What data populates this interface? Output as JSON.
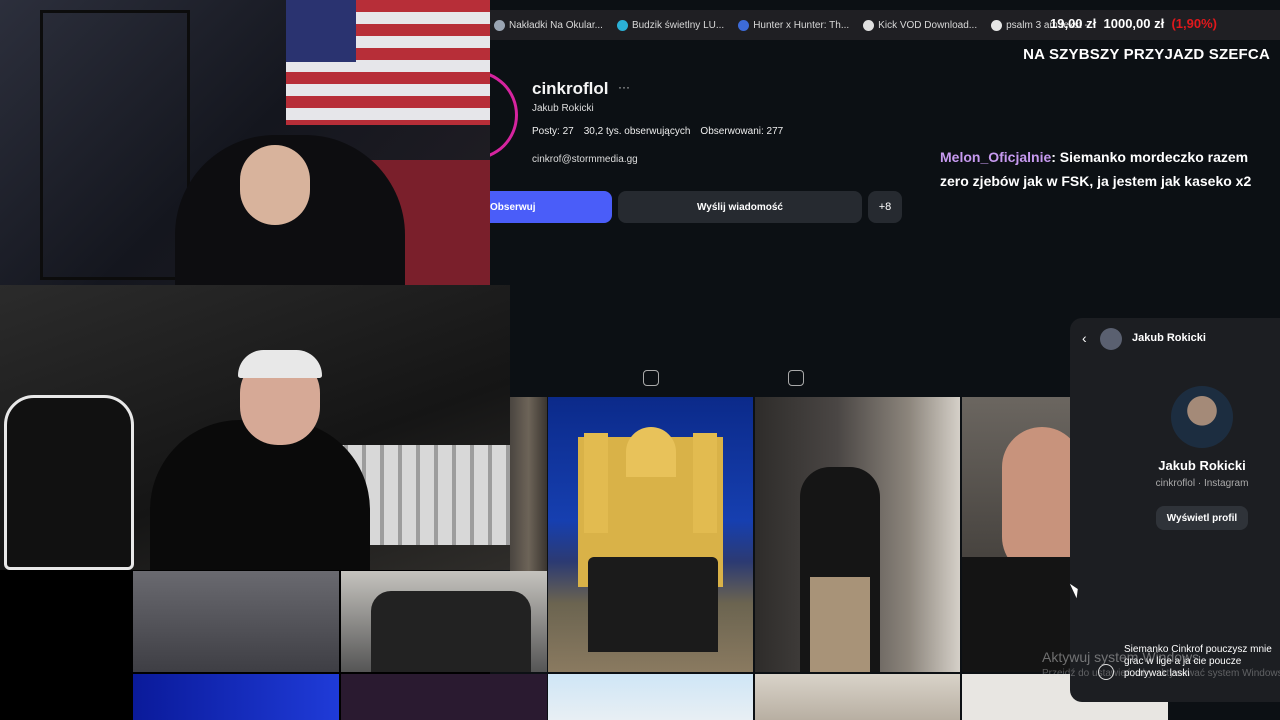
{
  "bookmarks": [
    {
      "label": "Nakładki Na Okular...",
      "color": "#9aa4b2"
    },
    {
      "label": "Budzik świetlny LU...",
      "color": "#2bb0d6"
    },
    {
      "label": "Hunter x Hunter: Th...",
      "color": "#3d6bd8"
    },
    {
      "label": "Kick VOD Download...",
      "color": "#e0e0e0"
    },
    {
      "label": "psalm 3 am tekst -...",
      "color": "#e5e5e5"
    }
  ],
  "goal": {
    "current": "19,00 zł",
    "target": "1000,00 zł",
    "percent": "(1,90%)",
    "title": "NA SZYBSZY PRZYJAZD SZEFCA"
  },
  "profile": {
    "username": "cinkroflol",
    "more_icon": "···",
    "full_name": "Jakub Rokicki",
    "posts": "Posty: 27",
    "followers": "30,2 tys. obserwujących",
    "following": "Obserwowani: 277",
    "email": "cinkrof@stormmedia.gg",
    "follow_label": "Obserwuj",
    "message_label": "Wyślij wiadomość",
    "add_icon": "+8"
  },
  "chat": {
    "user": "Melon_Oficjalnie",
    "message": ": Siemanko mordeczko razem zero zjebów jak w FSK, ja jestem jak kaseko x2"
  },
  "dm": {
    "back_icon": "‹",
    "header_name": "Jakub Rokicki",
    "name": "Jakub Rokicki",
    "sub": "cinkroflol · Instagram",
    "view_profile": "Wyświetl profil",
    "draft": "Siemanko Cinkrof pouczysz mnie grac w lige a ja cie poucze podrywac laski"
  },
  "windows": {
    "activate": "Aktywuj system Windows",
    "activate_sub": "Przejdź do ustawień, aby aktywować system Windows"
  }
}
